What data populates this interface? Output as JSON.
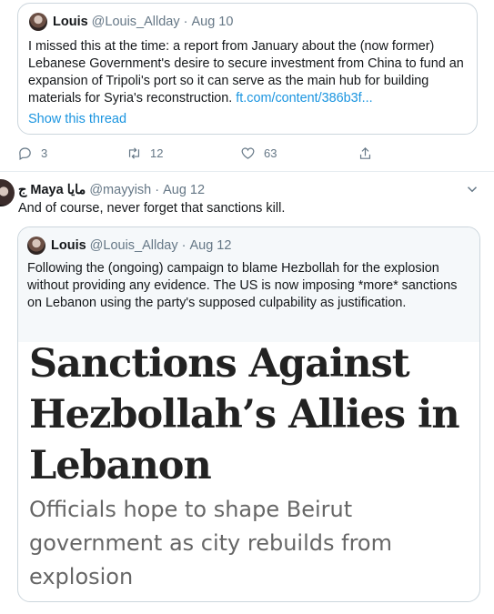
{
  "quoted_tweet": {
    "name": "Louis",
    "handle": "@Louis_Allday",
    "date": "Aug 10",
    "text": "I missed this at the time: a report from January about the (now former) Lebanese Government's desire to secure  investment from China to fund an expansion of Tripoli's port so it can serve as the main hub for building materials for Syria's reconstruction.",
    "link": "ft.com/content/386b3f...",
    "show_thread": "Show this thread",
    "actions": {
      "replies": "3",
      "retweets": "12",
      "likes": "63"
    }
  },
  "reply_tweet": {
    "name": "Maya مايا",
    "flag": "ج",
    "handle": "@mayyish",
    "date": "Aug 12",
    "text": "And of course, never forget that sanctions kill."
  },
  "embedded_tweet": {
    "name": "Louis",
    "handle": "@Louis_Allday",
    "date": "Aug 12",
    "text": "Following the (ongoing) campaign to blame Hezbollah for the explosion without providing any evidence. The US is now imposing *more* sanctions on Lebanon using the party's supposed culpability as justification.",
    "article_headline": "Sanctions Against Hezbollah’s Allies in Lebanon",
    "article_subhead": "Officials hope to shape Beirut government as city rebuilds from explosion"
  },
  "icons": {
    "reply": "reply-icon",
    "retweet": "retweet-icon",
    "like": "heart-icon",
    "share": "share-icon",
    "more": "chevron-down-icon"
  },
  "colors": {
    "link": "#1b95e0",
    "muted": "#657786",
    "border": "#ccd6dd"
  }
}
